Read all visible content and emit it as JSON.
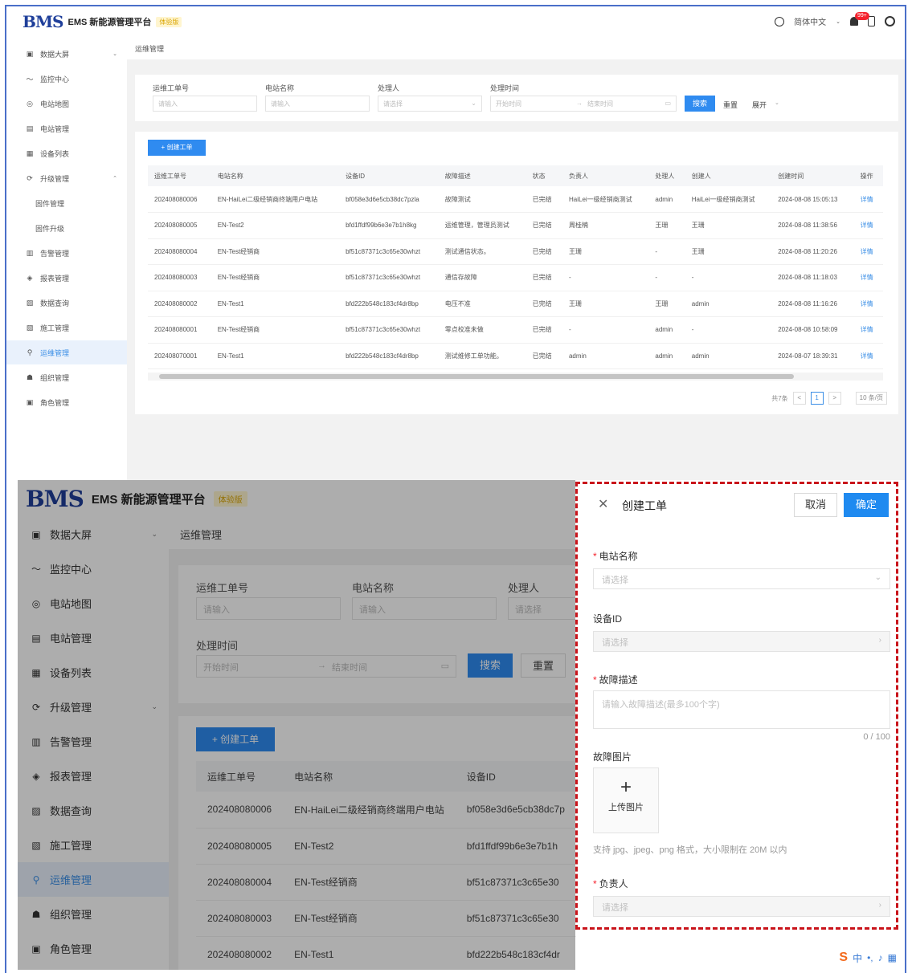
{
  "top": {
    "brand": "BMS",
    "app_title": "EMS 新能源管理平台",
    "badge": "体验版",
    "lang": "简体中文",
    "notif_count": "99+",
    "sidebar": [
      {
        "icon": "monitor-icon",
        "glyph": "▣",
        "label": "数据大屏",
        "arrow": "⌄"
      },
      {
        "icon": "trend-icon",
        "glyph": "〜",
        "label": "监控中心"
      },
      {
        "icon": "location-icon",
        "glyph": "◎",
        "label": "电站地图"
      },
      {
        "icon": "station-icon",
        "glyph": "▤",
        "label": "电站管理"
      },
      {
        "icon": "device-icon",
        "glyph": "▦",
        "label": "设备列表"
      },
      {
        "icon": "upgrade-icon",
        "glyph": "⟳",
        "label": "升级管理",
        "arrow": "⌃"
      },
      {
        "icon": "",
        "glyph": "",
        "label": "固件管理",
        "sub": true
      },
      {
        "icon": "",
        "glyph": "",
        "label": "固件升级",
        "sub": true
      },
      {
        "icon": "alarm-icon",
        "glyph": "▥",
        "label": "告警管理"
      },
      {
        "icon": "report-icon",
        "glyph": "◈",
        "label": "报表管理"
      },
      {
        "icon": "query-icon",
        "glyph": "▨",
        "label": "数据查询"
      },
      {
        "icon": "construction-icon",
        "glyph": "▧",
        "label": "施工管理"
      },
      {
        "icon": "maintenance-icon",
        "glyph": "⚲",
        "label": "运维管理",
        "active": true
      },
      {
        "icon": "org-icon",
        "glyph": "☗",
        "label": "组织管理"
      },
      {
        "icon": "role-icon",
        "glyph": "▣",
        "label": "角色管理"
      }
    ],
    "breadcrumb": "运维管理",
    "filters": {
      "order_no_label": "运维工单号",
      "order_no_ph": "请输入",
      "station_label": "电站名称",
      "station_ph": "请输入",
      "handler_label": "处理人",
      "handler_ph": "请选择",
      "time_label": "处理时间",
      "time_start_ph": "开始时间",
      "time_sep": "→",
      "time_end_ph": "结束时间",
      "search": "搜索",
      "reset": "重置",
      "expand": "展开"
    },
    "create_btn": "+ 创建工单",
    "columns": [
      "运维工单号",
      "电站名称",
      "设备ID",
      "故障描述",
      "状态",
      "负责人",
      "处理人",
      "创建人",
      "创建时间",
      "操作"
    ],
    "rows": [
      [
        "202408080006",
        "EN-HaiLei二级经销商终端用户电站",
        "bf058e3d6e5cb38dc7pzla",
        "故障测试",
        "已完结",
        "HaiLei一级经销商测试",
        "admin",
        "HaiLei一级经销商测试",
        "2024-08-08 15:05:13",
        "详情"
      ],
      [
        "202408080005",
        "EN-Test2",
        "bfd1ffdf99b6e3e7b1h8kg",
        "运维管理，管理员测试",
        "已完结",
        "周桂楠",
        "王珊",
        "王珊",
        "2024-08-08 11:38:56",
        "详情"
      ],
      [
        "202408080004",
        "EN-Test经销商",
        "bf51c87371c3c65e30whzt",
        "测试通信状态。",
        "已完结",
        "王珊",
        "-",
        "王珊",
        "2024-08-08 11:20:26",
        "详情"
      ],
      [
        "202408080003",
        "EN-Test经销商",
        "bf51c87371c3c65e30whzt",
        "通信存故障",
        "已完结",
        "-",
        "-",
        "-",
        "2024-08-08 11:18:03",
        "详情"
      ],
      [
        "202408080002",
        "EN-Test1",
        "bfd222b548c183cf4dr8bp",
        "电压不准",
        "已完结",
        "王珊",
        "王珊",
        "admin",
        "2024-08-08 11:16:26",
        "详情"
      ],
      [
        "202408080001",
        "EN-Test经销商",
        "bf51c87371c3c65e30whzt",
        "零点校准未做",
        "已完结",
        "-",
        "admin",
        "-",
        "2024-08-08 10:58:09",
        "详情"
      ],
      [
        "202408070001",
        "EN-Test1",
        "bfd222b548c183cf4dr8bp",
        "测试维修工单功能。",
        "已完结",
        "admin",
        "admin",
        "admin",
        "2024-08-07 18:39:31",
        "详情"
      ]
    ],
    "pager": {
      "total": "共7条",
      "prev": "<",
      "page": "1",
      "next": ">",
      "size": "10 条/页"
    }
  },
  "bottom": {
    "brand": "BMS",
    "app_title": "EMS 新能源管理平台",
    "badge": "体验版",
    "sidebar": [
      {
        "icon": "monitor-icon",
        "glyph": "▣",
        "label": "数据大屏",
        "arrow": "⌄"
      },
      {
        "icon": "trend-icon",
        "glyph": "〜",
        "label": "监控中心"
      },
      {
        "icon": "location-icon",
        "glyph": "◎",
        "label": "电站地图"
      },
      {
        "icon": "station-icon",
        "glyph": "▤",
        "label": "电站管理"
      },
      {
        "icon": "device-icon",
        "glyph": "▦",
        "label": "设备列表"
      },
      {
        "icon": "upgrade-icon",
        "glyph": "⟳",
        "label": "升级管理",
        "arrow": "⌄"
      },
      {
        "icon": "alarm-icon",
        "glyph": "▥",
        "label": "告警管理"
      },
      {
        "icon": "report-icon",
        "glyph": "◈",
        "label": "报表管理"
      },
      {
        "icon": "query-icon",
        "glyph": "▨",
        "label": "数据查询"
      },
      {
        "icon": "construction-icon",
        "glyph": "▧",
        "label": "施工管理"
      },
      {
        "icon": "maintenance-icon",
        "glyph": "⚲",
        "label": "运维管理",
        "active": true
      },
      {
        "icon": "org-icon",
        "glyph": "☗",
        "label": "组织管理"
      },
      {
        "icon": "role-icon",
        "glyph": "▣",
        "label": "角色管理"
      }
    ],
    "breadcrumb": "运维管理",
    "filters": {
      "order_no_label": "运维工单号",
      "order_no_ph": "请输入",
      "station_label": "电站名称",
      "station_ph": "请输入",
      "handler_label": "处理人",
      "handler_ph": "请选择",
      "time_label": "处理时间",
      "time_start_ph": "开始时间",
      "time_sep": "→",
      "time_end_ph": "结束时间",
      "search": "搜索",
      "reset": "重置"
    },
    "create_btn": "+ 创建工单",
    "columns": [
      "运维工单号",
      "电站名称",
      "设备ID"
    ],
    "rows": [
      [
        "202408080006",
        "EN-HaiLei二级经销商终端用户电站",
        "bf058e3d6e5cb38dc7p"
      ],
      [
        "202408080005",
        "EN-Test2",
        "bfd1ffdf99b6e3e7b1h"
      ],
      [
        "202408080004",
        "EN-Test经销商",
        "bf51c87371c3c65e30"
      ],
      [
        "202408080003",
        "EN-Test经销商",
        "bf51c87371c3c65e30"
      ],
      [
        "202408080002",
        "EN-Test1",
        "bfd222b548c183cf4dr"
      ]
    ],
    "drawer": {
      "title": "创建工单",
      "cancel": "取消",
      "confirm": "确定",
      "station_label": "电站名称",
      "station_ph": "请选择",
      "device_label": "设备ID",
      "device_ph": "请选择",
      "fault_label": "故障描述",
      "fault_ph": "请输入故障描述(最多100个字)",
      "fault_count": "0 / 100",
      "image_label": "故障图片",
      "upload_plus": "+",
      "upload_text": "上传图片",
      "upload_hint": "支持 jpg、jpeg、png 格式，大小限制在 20M 以内",
      "owner_label": "负责人",
      "owner_ph": "请选择"
    },
    "ime": "中"
  },
  "colors": {
    "accent": "#1f8af0",
    "brand": "#1f3f9a",
    "annotation": "#c9141b"
  }
}
